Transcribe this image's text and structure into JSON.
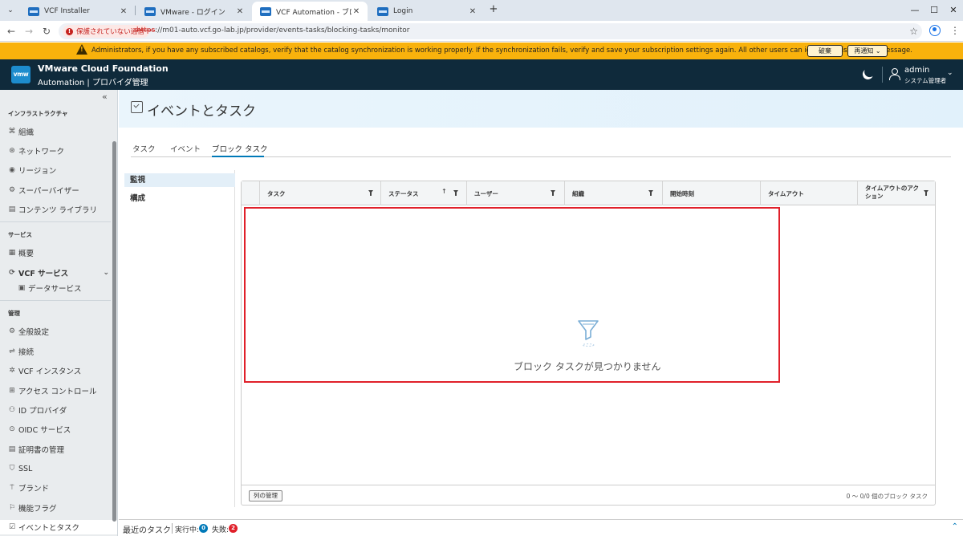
{
  "browser": {
    "tabs": [
      {
        "label": "VCF Installer",
        "active": false
      },
      {
        "label": "VMware - ログイン",
        "active": false
      },
      {
        "label": "VCF Automation - ブロック タスク",
        "active": true
      },
      {
        "label": "Login",
        "active": false
      }
    ],
    "security_chip": "保護されていない通信",
    "url_scheme": "https",
    "url_rest": "://m01-auto.vcf.go-lab.jp/provider/events-tasks/blocking-tasks/monitor"
  },
  "banner": {
    "message": "Administrators, if you have any subscribed catalogs, verify that the catalog synchronization is working properly. If the synchronization fails, verify and save your subscription settings again. All other users can ignore or dismiss this message.",
    "dismiss_label": "破棄",
    "remind_label": "再通知",
    "color": "#f9b20c"
  },
  "header": {
    "logo_text": "vmw",
    "title": "VMware Cloud Foundation",
    "subtitle": "Automation | プロバイダ管理",
    "user_name": "admin",
    "user_role": "システム管理者"
  },
  "sidebar": {
    "section_infra": "インフラストラクチャ",
    "infra_items": [
      "組織",
      "ネットワーク",
      "リージョン",
      "スーパーバイザー",
      "コンテンツ ライブラリ"
    ],
    "section_services": "サービス",
    "service_overview": "概要",
    "vcf_services": "VCF サービス",
    "data_services": "データサービス",
    "section_admin": "管理",
    "admin_items": [
      "全般設定",
      "接続",
      "VCF インスタンス",
      "アクセス コントロール",
      "ID プロバイダ",
      "OIDC サービス",
      "証明書の管理",
      "SSL",
      "ブランド",
      "機能フラグ"
    ],
    "active_item": "イベントとタスク"
  },
  "page": {
    "title": "イベントとタスク",
    "tabs": [
      "タスク",
      "イベント",
      "ブロック タスク"
    ],
    "active_tab": "ブロック タスク",
    "leftnav": [
      "監視",
      "構成"
    ],
    "active_leftnav": "監視"
  },
  "grid": {
    "columns": [
      "タスク",
      "ステータス",
      "ユーザー",
      "組織",
      "開始時刻",
      "タイムアウト",
      "タイムアウトのアクション"
    ],
    "empty_text": "ブロック タスクが見つかりません",
    "manage_columns": "列の管理",
    "footer_count": "0 ～ 0/0 個のブロック タスク"
  },
  "taskbar": {
    "title": "最近のタスク",
    "running_label": "実行中:",
    "running_count": "0",
    "failed_label": "失敗:",
    "failed_count": "2"
  },
  "colors": {
    "header_bg": "#0f2a3b",
    "accent": "#0079b8",
    "highlight": "#e0202a"
  }
}
